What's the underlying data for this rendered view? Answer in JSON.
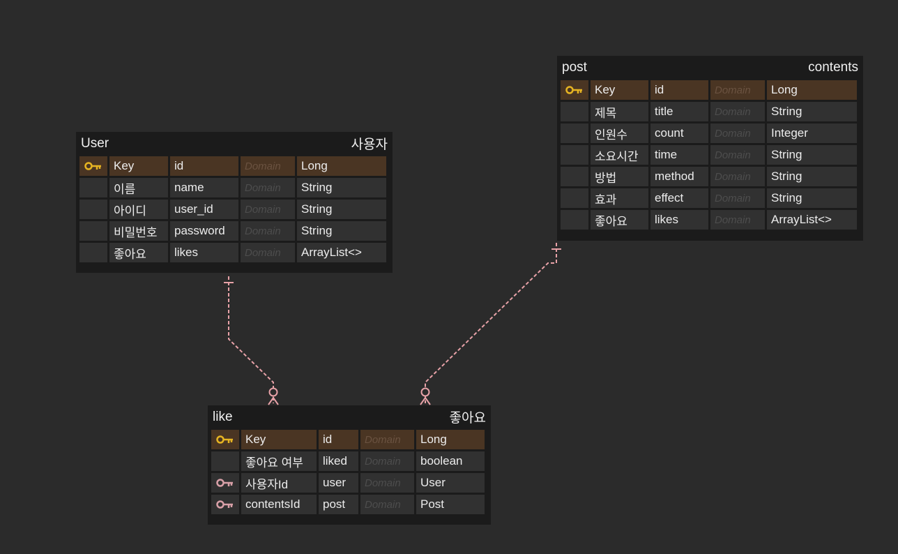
{
  "colors": {
    "background": "#2b2b2b",
    "entity_bg": "#1b1b1b",
    "cell_bg": "#313131",
    "pk_row_bg": "#4a3523",
    "primary_key_icon": "#e6b422",
    "foreign_key_icon": "#d9a0a8",
    "relationship_line": "#e8a2a8"
  },
  "entities": {
    "user": {
      "name": "User",
      "alias": "사용자",
      "columns": [
        {
          "key": "primary-key-icon",
          "logical": "Key",
          "physical": "id",
          "domain": "Domain",
          "type": "Long"
        },
        {
          "key": "",
          "logical": "이름",
          "physical": "name",
          "domain": "Domain",
          "type": "String"
        },
        {
          "key": "",
          "logical": "아이디",
          "physical": "user_id",
          "domain": "Domain",
          "type": "String"
        },
        {
          "key": "",
          "logical": "비밀번호",
          "physical": "password",
          "domain": "Domain",
          "type": "String"
        },
        {
          "key": "",
          "logical": "좋아요",
          "physical": "likes",
          "domain": "Domain",
          "type": "ArrayList<>"
        }
      ]
    },
    "post": {
      "name": "post",
      "alias": "contents",
      "columns": [
        {
          "key": "primary-key-icon",
          "logical": "Key",
          "physical": "id",
          "domain": "Domain",
          "type": "Long"
        },
        {
          "key": "",
          "logical": "제목",
          "physical": "title",
          "domain": "Domain",
          "type": "String"
        },
        {
          "key": "",
          "logical": "인원수",
          "physical": "count",
          "domain": "Domain",
          "type": "Integer"
        },
        {
          "key": "",
          "logical": "소요시간",
          "physical": "time",
          "domain": "Domain",
          "type": "String"
        },
        {
          "key": "",
          "logical": "방법",
          "physical": "method",
          "domain": "Domain",
          "type": "String"
        },
        {
          "key": "",
          "logical": "효과",
          "physical": "effect",
          "domain": "Domain",
          "type": "String"
        },
        {
          "key": "",
          "logical": "좋아요",
          "physical": "likes",
          "domain": "Domain",
          "type": "ArrayList<>"
        }
      ]
    },
    "like": {
      "name": "like",
      "alias": "좋아요",
      "columns": [
        {
          "key": "primary-key-icon",
          "logical": "Key",
          "physical": "id",
          "domain": "Domain",
          "type": "Long"
        },
        {
          "key": "",
          "logical": "좋아요 여부",
          "physical": "liked",
          "domain": "Domain",
          "type": "boolean"
        },
        {
          "key": "foreign-key-icon",
          "logical": "사용자Id",
          "physical": "user",
          "domain": "Domain",
          "type": "User"
        },
        {
          "key": "foreign-key-icon",
          "logical": "contentsId",
          "physical": "post",
          "domain": "Domain",
          "type": "Post"
        }
      ]
    }
  },
  "relationships": [
    {
      "from": "user",
      "to": "like",
      "from_cardinality": "one",
      "to_cardinality": "zero-or-many"
    },
    {
      "from": "post",
      "to": "like",
      "from_cardinality": "one",
      "to_cardinality": "zero-or-many"
    }
  ]
}
